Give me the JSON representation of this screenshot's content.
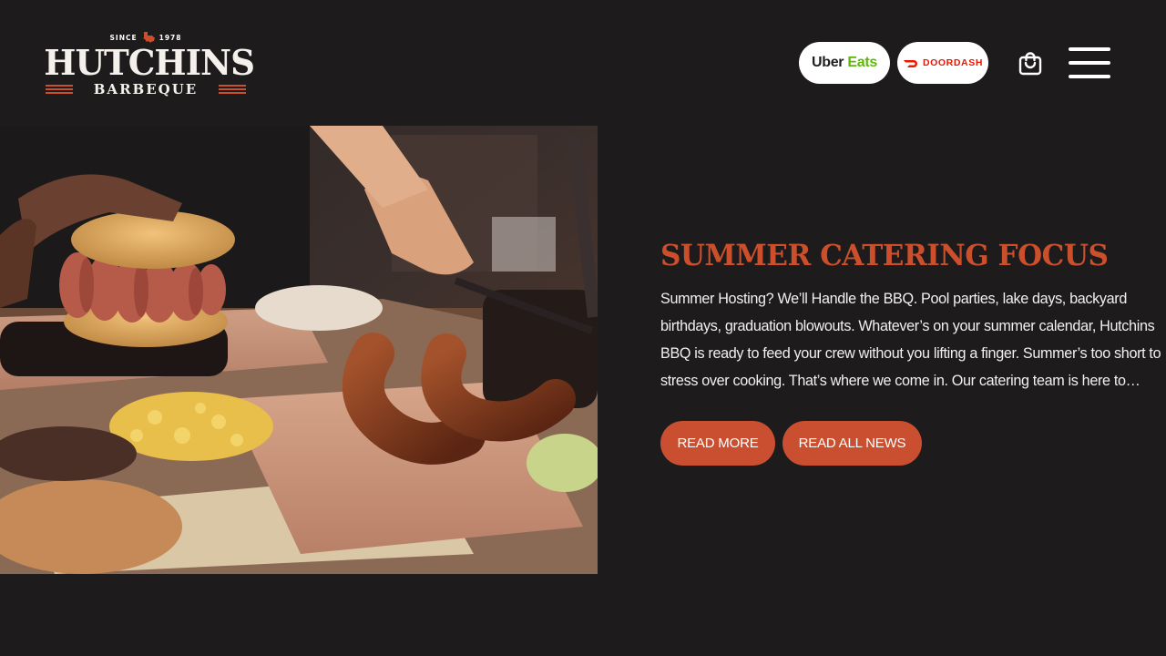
{
  "brand": {
    "since_left": "SINCE",
    "since_right": "1978",
    "name": "HUTCHINS",
    "subtitle": "BARBEQUE"
  },
  "delivery": {
    "uber_prefix": "Uber",
    "uber_suffix": "Eats",
    "doordash": "DOORDASH"
  },
  "icons": {
    "cart": "shopping-bag-icon",
    "menu": "hamburger-menu-icon"
  },
  "post": {
    "title": "SUMMER CATERING FOCUS",
    "excerpt": "Summer Hosting? We’ll Handle the BBQ. Pool parties, lake days, backyard birthdays, graduation blowouts. Whatever’s on your summer calendar, Hutchins BBQ is ready to feed your crew without you lifting a finger. Summer’s too short to stress over cooking. That’s where we come in. Our catering team is here to…",
    "read_more": "READ MORE",
    "read_all": "READ ALL NEWS"
  },
  "colors": {
    "background": "#1d1b1c",
    "accent": "#cc4f2c",
    "button": "#c94f30",
    "uber_green": "#5fb709",
    "doordash_red": "#eb1700"
  }
}
